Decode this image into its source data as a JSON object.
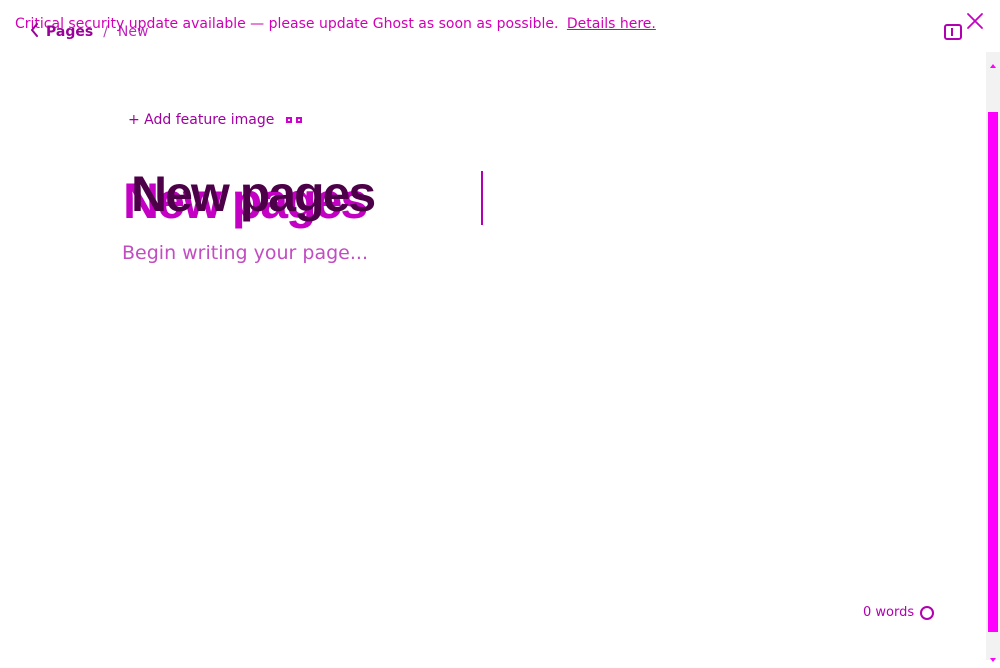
{
  "banner": {
    "text": "Critical security update available — please update Ghost as soon as possible.",
    "link": "Details here."
  },
  "breadcrumbs": {
    "back_label": "Pages",
    "current_label": "New"
  },
  "feature_image": {
    "label": "+ Add feature image"
  },
  "editor": {
    "title": "New pages",
    "body_placeholder": "Begin writing your page..."
  },
  "footer": {
    "word_count": "0 words"
  },
  "icons": {
    "close": "close-icon",
    "back": "chevron-left-icon",
    "sidebar_toggle": "sidebar-toggle-icon",
    "feature_image": "image-icon",
    "help": "help-icon"
  },
  "colors": {
    "accent": "#ff00ff",
    "accent_dark": "#4b0048",
    "accent_text": "#d100b6"
  }
}
